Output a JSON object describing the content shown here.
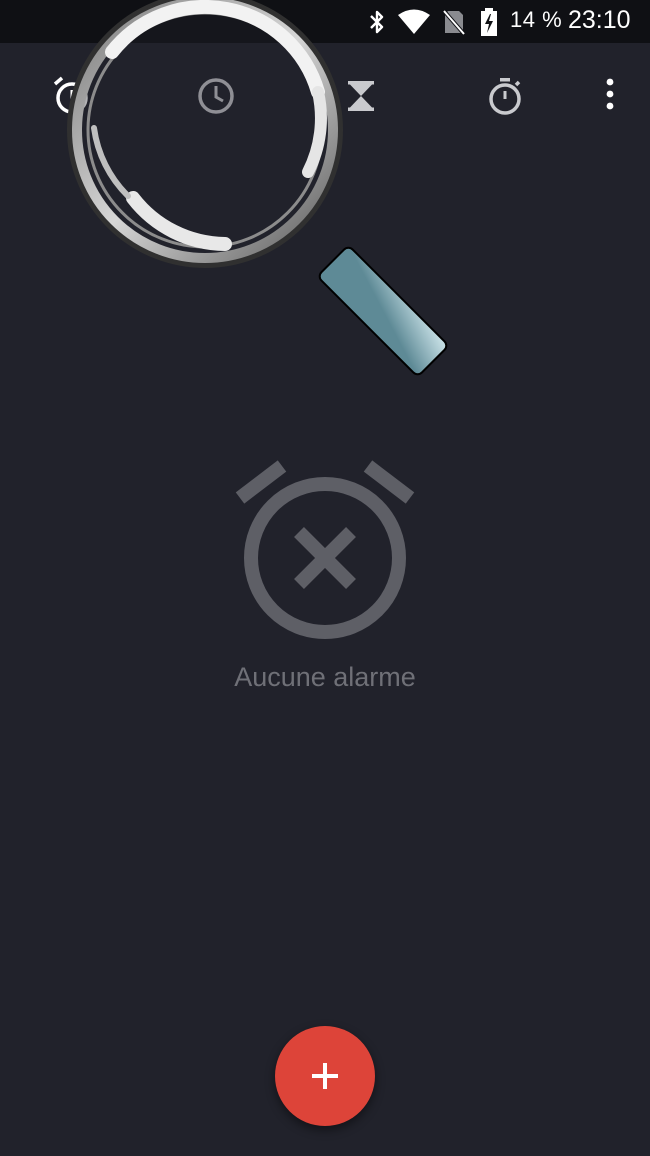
{
  "status_bar": {
    "battery_percent": "14 %",
    "time": "23:10",
    "icons": [
      "bluetooth-icon",
      "wifi-icon",
      "no-sim-icon",
      "battery-charging-icon"
    ]
  },
  "tabs": [
    {
      "icon": "alarm-icon",
      "selected": true
    },
    {
      "icon": "clock-icon",
      "selected": false
    },
    {
      "icon": "hourglass-icon",
      "selected": false
    },
    {
      "icon": "stopwatch-icon",
      "selected": false
    }
  ],
  "overflow_menu": {
    "icon": "more-vert-icon"
  },
  "empty_state": {
    "icon": "alarm-off-icon",
    "label": "Aucune alarme"
  },
  "fab": {
    "icon": "plus-icon"
  },
  "colors": {
    "background": "#21222b",
    "status_bar": "#0f1014",
    "fab": "#dd4439",
    "muted": "#6f7077",
    "empty_icon": "#5e5f66",
    "magnifier_handle": "#8fb8c4"
  }
}
